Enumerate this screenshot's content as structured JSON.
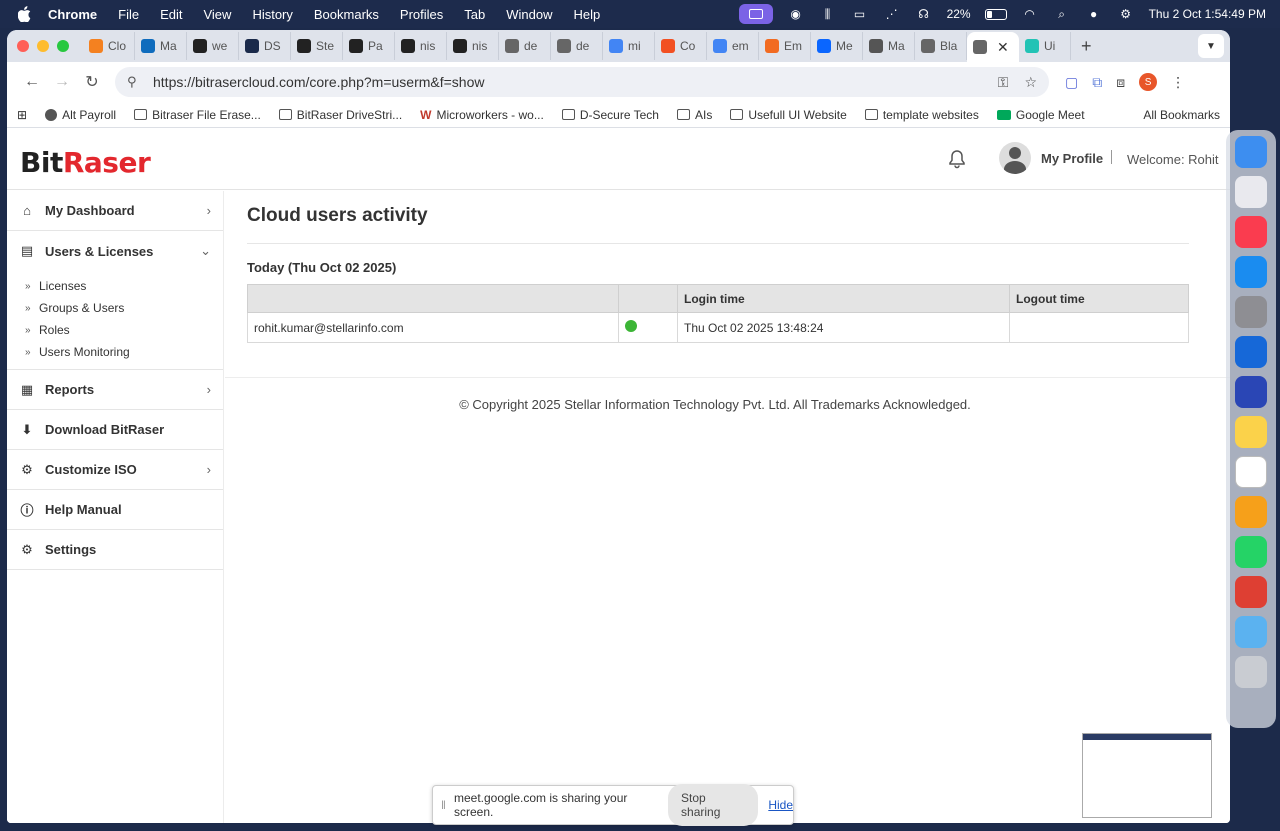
{
  "menubar": {
    "app_name": "Chrome",
    "items": [
      "File",
      "Edit",
      "View",
      "History",
      "Bookmarks",
      "Profiles",
      "Tab",
      "Window",
      "Help"
    ],
    "battery": "22%",
    "datetime": "Thu 2 Oct  1:54:49 PM"
  },
  "tabs": [
    {
      "label": "Clo",
      "color": "#f48120"
    },
    {
      "label": "Ma",
      "color": "#0f6cbd"
    },
    {
      "label": "we",
      "color": "#222222"
    },
    {
      "label": "DS",
      "color": "#1a2a4a"
    },
    {
      "label": "Ste",
      "color": "#222222"
    },
    {
      "label": "Pa",
      "color": "#222222"
    },
    {
      "label": "nis",
      "color": "#222222"
    },
    {
      "label": "nis",
      "color": "#222222"
    },
    {
      "label": "de",
      "color": "#666666"
    },
    {
      "label": "de",
      "color": "#666666"
    },
    {
      "label": "mi",
      "color": "#4285f4"
    },
    {
      "label": "Co",
      "color": "#f25022"
    },
    {
      "label": "em",
      "color": "#4285f4"
    },
    {
      "label": "Em",
      "color": "#f26b21"
    },
    {
      "label": "Me",
      "color": "#0a66ff"
    },
    {
      "label": "Ma",
      "color": "#555555"
    },
    {
      "label": "Bla",
      "color": "#666666"
    },
    {
      "label": "",
      "color": "#666666"
    },
    {
      "label": "Ui",
      "color": "#22c3b5"
    }
  ],
  "toolbar": {
    "url": "https://bitrasercloud.com/core.php?m=userm&f=show",
    "profile_initial": "S"
  },
  "bookmarks": {
    "items": [
      "Alt Payroll",
      "Bitraser File Erase...",
      "BitRaser DriveStri...",
      "Microworkers - wo...",
      "D-Secure Tech",
      "AIs",
      "Usefull UI Website",
      "template websites",
      "Google Meet"
    ],
    "all": "All Bookmarks"
  },
  "header": {
    "logo_bit": "Bit",
    "logo_raser": "Raser",
    "profile_label": "My Profile",
    "welcome": "Welcome: Rohit"
  },
  "sidebar": {
    "dashboard": "My Dashboard",
    "users_licenses": "Users & Licenses",
    "sub_items": [
      "Licenses",
      "Groups & Users",
      "Roles",
      "Users Monitoring"
    ],
    "reports": "Reports",
    "download": "Download BitRaser",
    "customize": "Customize ISO",
    "help": "Help Manual",
    "settings": "Settings"
  },
  "main": {
    "title": "Cloud users activity",
    "today": "Today (Thu Oct 02 2025)",
    "columns": [
      "",
      "",
      "Login time",
      "Logout time"
    ],
    "rows": [
      {
        "user": "rohit.kumar@stellarinfo.com",
        "status_color": "#3cb536",
        "login": "Thu Oct 02 2025 13:48:24",
        "logout": ""
      }
    ],
    "copyright": "© Copyright 2025 Stellar Information Technology Pvt. Ltd. All Trademarks Acknowledged."
  },
  "sharebar": {
    "message": "meet.google.com is sharing your screen.",
    "stop": "Stop sharing",
    "hide": "Hide"
  },
  "dock_apps": [
    {
      "name": "finder-icon",
      "color": "#3d8ef0"
    },
    {
      "name": "launchpad-icon",
      "color": "#e9e9ee"
    },
    {
      "name": "music-icon",
      "color": "#fa3c4f"
    },
    {
      "name": "app-store-icon",
      "color": "#1a8cf0"
    },
    {
      "name": "system-settings-icon",
      "color": "#8e8e93"
    },
    {
      "name": "remote-desktop-icon",
      "color": "#1668d8"
    },
    {
      "name": "screen-app-icon",
      "color": "#2a46b5"
    },
    {
      "name": "notes-icon",
      "color": "#fbd24a"
    },
    {
      "name": "chatgpt-icon",
      "color": "#ffffff"
    },
    {
      "name": "photos-icon",
      "color": "#f6a01a"
    },
    {
      "name": "whatsapp-icon",
      "color": "#25d366"
    },
    {
      "name": "chrome-icon",
      "color": "#de3f33"
    },
    {
      "name": "folder-icon",
      "color": "#5bb2f0"
    },
    {
      "name": "trash-icon",
      "color": "#c9ccd2"
    }
  ]
}
